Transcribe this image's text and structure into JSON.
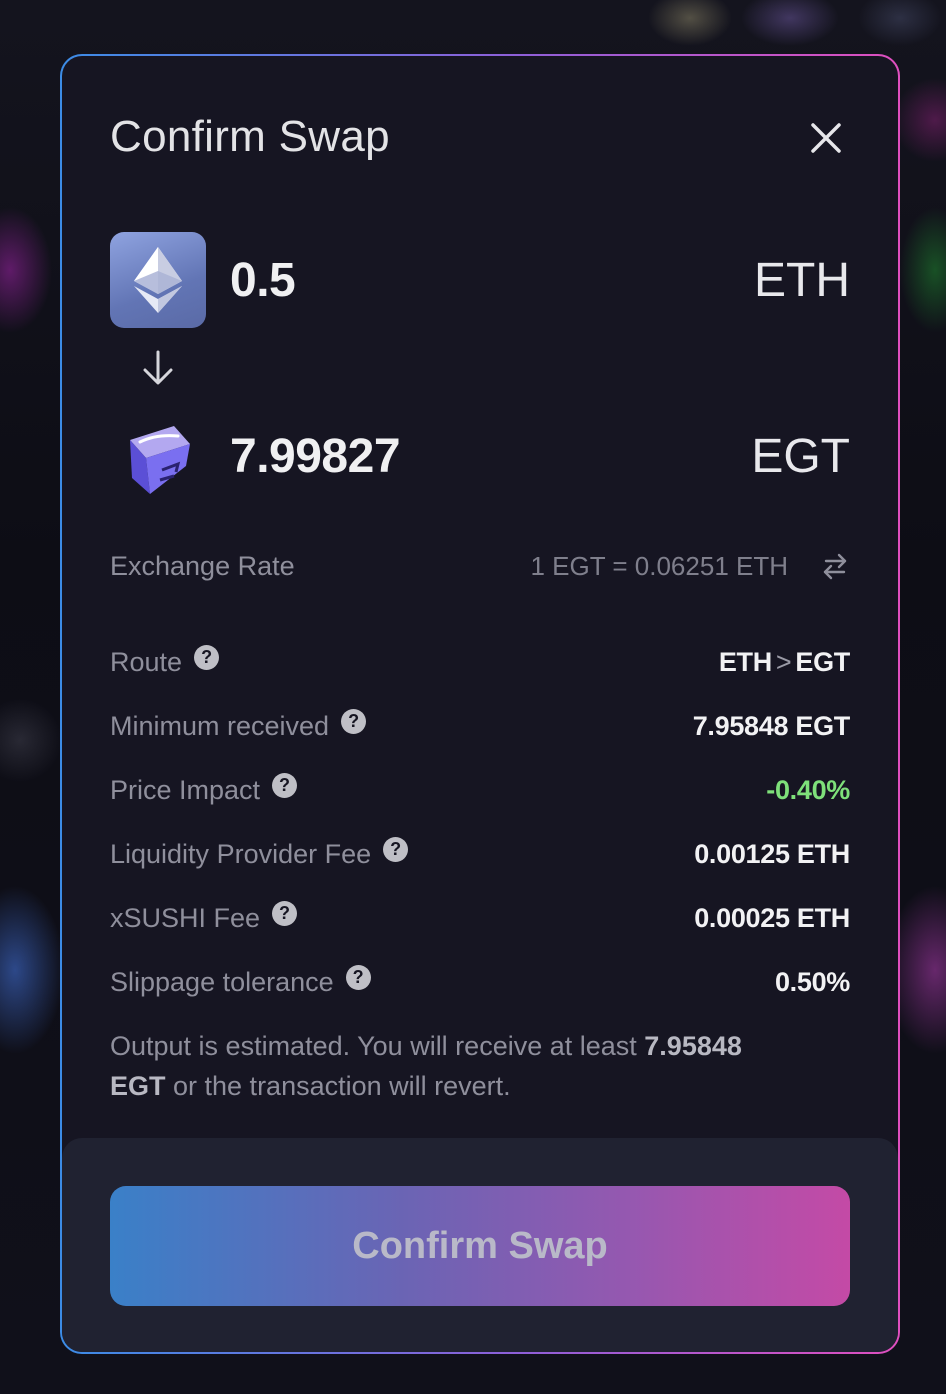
{
  "modal": {
    "title": "Confirm Swap"
  },
  "from_token": {
    "amount": "0.5",
    "symbol": "ETH"
  },
  "to_token": {
    "amount": "7.99827",
    "symbol": "EGT"
  },
  "exchange_rate": {
    "label": "Exchange Rate",
    "value": "1 EGT = 0.06251 ETH"
  },
  "details": [
    {
      "label": "Route",
      "value": ""
    },
    {
      "label": "Minimum received",
      "value": "7.95848 EGT"
    },
    {
      "label": "Price Impact",
      "value": "-0.40%"
    },
    {
      "label": "Liquidity Provider Fee",
      "value": "0.00125 ETH"
    },
    {
      "label": "xSUSHI Fee",
      "value": "0.00025 ETH"
    },
    {
      "label": "Slippage tolerance",
      "value": "0.50%"
    }
  ],
  "route": {
    "from": "ETH",
    "separator": ">",
    "to": "EGT"
  },
  "note": {
    "prefix": "Output is estimated. You will receive at least ",
    "amount": "7.95848",
    "symbol": "EGT",
    "suffix": " or the transaction will revert."
  },
  "confirm_button": {
    "label": "Confirm Swap"
  },
  "colors": {
    "positive": "#7ee07a",
    "accent_start": "#3a80c8",
    "accent_end": "#c44aa6"
  },
  "icons": {
    "close": "close-icon",
    "help": "help-icon",
    "arrow": "arrow-down-icon",
    "swap": "swap-rate-icon",
    "eth": "ethereum-icon",
    "egt": "egt-cube-icon"
  }
}
